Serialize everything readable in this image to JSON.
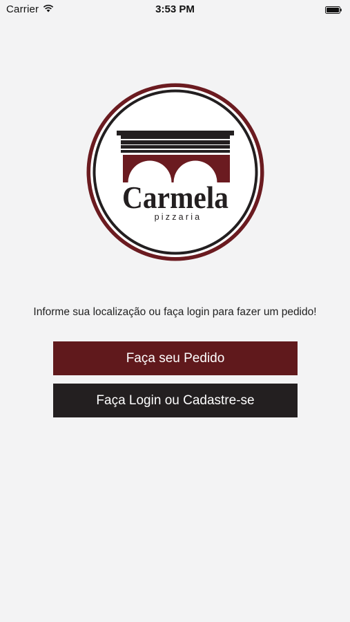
{
  "status_bar": {
    "carrier": "Carrier",
    "time": "3:53 PM",
    "icons": [
      "wifi-icon",
      "battery-icon"
    ]
  },
  "logo": {
    "name": "Carmela",
    "tagline": "pizzaria",
    "colors": {
      "maroon": "#6b1b20",
      "charcoal": "#231f20"
    }
  },
  "prompt_text": "Informe sua localização ou faça login para fazer um pedido!",
  "buttons": {
    "order_label": "Faça seu Pedido",
    "login_label": "Faça Login ou Cadastre-se"
  },
  "colors": {
    "background": "#f3f3f4",
    "order_button": "#60191c",
    "login_button": "#231f20",
    "button_text": "#ffffff"
  }
}
